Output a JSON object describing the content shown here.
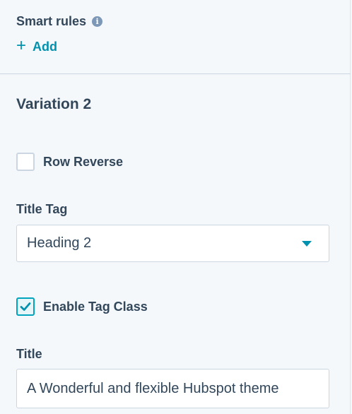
{
  "smart_rules": {
    "label": "Smart rules",
    "info_icon": "i",
    "add_label": "Add",
    "add_icon": "+"
  },
  "variation": {
    "title": "Variation 2"
  },
  "row_reverse": {
    "label": "Row Reverse",
    "checked": false
  },
  "title_tag": {
    "label": "Title Tag",
    "selected": "Heading 2"
  },
  "enable_tag_class": {
    "label": "Enable Tag Class",
    "checked": true
  },
  "title": {
    "label": "Title",
    "value": "A Wonderful and flexible Hubspot theme"
  },
  "colors": {
    "accent": "#0091ae",
    "checkbox_checked_border": "#00a4bd",
    "text": "#33475b",
    "background": "#f5f8fa"
  }
}
